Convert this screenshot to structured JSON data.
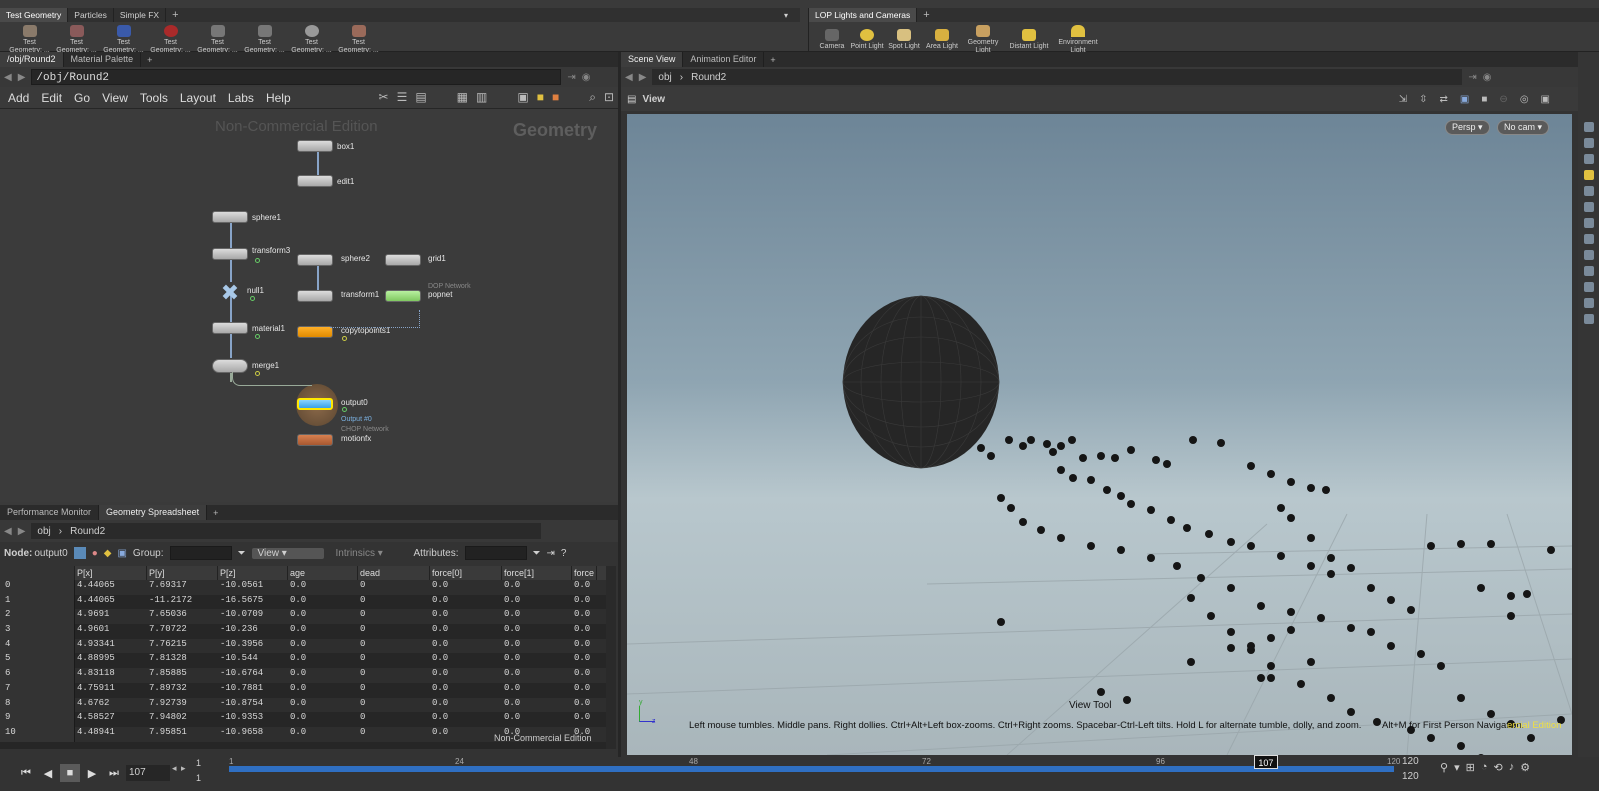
{
  "shelf_left": {
    "tabs": [
      "Test Geometry",
      "Particles",
      "Simple FX"
    ],
    "tools": [
      "Test Geometry: ...",
      "Test Geometry: ...",
      "Test Geometry: ...",
      "Test Geometry: ...",
      "Test Geometry: ...",
      "Test Geometry: ...",
      "Test Geometry: ...",
      "Test Geometry: ..."
    ]
  },
  "shelf_right": {
    "tabs": [
      "LOP Lights and Cameras"
    ],
    "tools": [
      "Camera",
      "Point Light",
      "Spot Light",
      "Area Light",
      "Geometry Light",
      "Distant Light",
      "Environment Light"
    ]
  },
  "network_pane": {
    "tabs": [
      "/obj/Round2",
      "Material Palette"
    ],
    "path": "/obj/Round2",
    "menu": [
      "Add",
      "Edit",
      "Go",
      "View",
      "Tools",
      "Layout",
      "Labs",
      "Help"
    ],
    "watermark": "Non-Commercial Edition",
    "context_label": "Geometry",
    "nodes": [
      {
        "name": "box1"
      },
      {
        "name": "edit1"
      },
      {
        "name": "sphere1"
      },
      {
        "name": "transform3"
      },
      {
        "name": "null1"
      },
      {
        "name": "material1"
      },
      {
        "name": "merge1"
      },
      {
        "name": "sphere2"
      },
      {
        "name": "transform1"
      },
      {
        "name": "copytopoints1"
      },
      {
        "name": "grid1"
      },
      {
        "name": "popnet",
        "subtitle": "DOP Network"
      },
      {
        "name": "output0",
        "subtitle": "Output #0"
      },
      {
        "name": "motionfx",
        "subtitle": "CHOP Network"
      }
    ]
  },
  "spreadsheet_pane": {
    "tabs": [
      "Performance Monitor",
      "Geometry Spreadsheet"
    ],
    "path_obj": "obj",
    "path_node": "Round2",
    "node_label": "Node:",
    "node_value": "output0",
    "group_label": "Group:",
    "view_label": "View",
    "intrinsics_label": "Intrinsics",
    "attributes_label": "Attributes:",
    "columns": [
      "",
      "P[x]",
      "P[y]",
      "P[z]",
      "age",
      "dead",
      "force[0]",
      "force[1]",
      "force"
    ],
    "rows": [
      [
        "0",
        "4.44065",
        "7.69317",
        "-10.0561",
        "0.0",
        "0",
        "0.0",
        "0.0",
        "0.0"
      ],
      [
        "1",
        "4.44065",
        "-11.2172",
        "-16.5675",
        "0.0",
        "0",
        "0.0",
        "0.0",
        "0.0"
      ],
      [
        "2",
        "4.9691",
        "7.65036",
        "-10.0709",
        "0.0",
        "0",
        "0.0",
        "0.0",
        "0.0"
      ],
      [
        "3",
        "4.9601",
        "7.70722",
        "-10.236",
        "0.0",
        "0",
        "0.0",
        "0.0",
        "0.0"
      ],
      [
        "4",
        "4.93341",
        "7.76215",
        "-10.3956",
        "0.0",
        "0",
        "0.0",
        "0.0",
        "0.0"
      ],
      [
        "5",
        "4.88995",
        "7.81328",
        "-10.544",
        "0.0",
        "0",
        "0.0",
        "0.0",
        "0.0"
      ],
      [
        "6",
        "4.83118",
        "7.85885",
        "-10.6764",
        "0.0",
        "0",
        "0.0",
        "0.0",
        "0.0"
      ],
      [
        "7",
        "4.75911",
        "7.89732",
        "-10.7881",
        "0.0",
        "0",
        "0.0",
        "0.0",
        "0.0"
      ],
      [
        "8",
        "4.6762",
        "7.92739",
        "-10.8754",
        "0.0",
        "0",
        "0.0",
        "0.0",
        "0.0"
      ],
      [
        "9",
        "4.58527",
        "7.94802",
        "-10.9353",
        "0.0",
        "0",
        "0.0",
        "0.0",
        "0.0"
      ],
      [
        "10",
        "4.48941",
        "7.95851",
        "-10.9658",
        "0.0",
        "0",
        "0.0",
        "0.0",
        "0.0"
      ]
    ],
    "watermark": "Non-Commercial Edition"
  },
  "viewer_pane": {
    "tabs": [
      "Scene View",
      "Animation Editor"
    ],
    "path_obj": "obj",
    "path_node": "Round2",
    "view_label": "View",
    "persp_button": "Persp",
    "cam_button": "No cam",
    "tool_title": "View Tool",
    "hint": "Left mouse tumbles. Middle pans. Right dollies. Ctrl+Alt+Left box-zooms. Ctrl+Right zooms. Spacebar-Ctrl-Left tilts. Hold L for alternate tumble, dolly, and zoom.",
    "hint2": "Alt+M for First Person Navigation.",
    "watermark_fragment": "ercial Edition",
    "axis_y": "y",
    "axis_z": "z"
  },
  "timeline": {
    "current_frame": "107",
    "start": "1",
    "start2": "1",
    "end": "120",
    "end2": "120",
    "ticks": [
      "1",
      "24",
      "48",
      "72",
      "96",
      "120"
    ],
    "marker": "107",
    "frame_progress": 0.89
  }
}
